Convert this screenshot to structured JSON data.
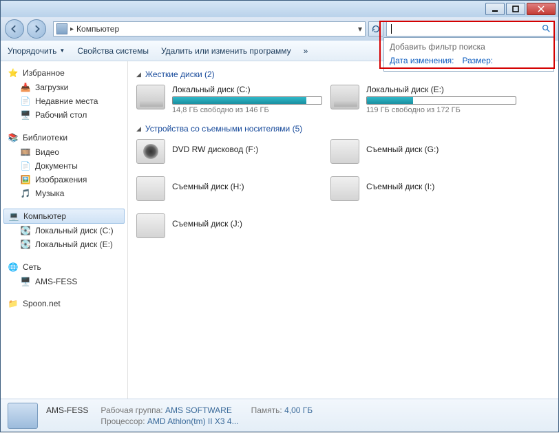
{
  "titlebar": {
    "min": "_",
    "max": "▢",
    "close": "✕"
  },
  "address": {
    "location": "Компьютер"
  },
  "search": {
    "value": "",
    "heading": "Добавить фильтр поиска",
    "filter_date": "Дата изменения:",
    "filter_size": "Размер:"
  },
  "toolbar": {
    "organize": "Упорядочить",
    "properties": "Свойства системы",
    "uninstall": "Удалить или изменить программу",
    "more": "»"
  },
  "sidebar": {
    "favorites": {
      "label": "Избранное",
      "items": [
        "Загрузки",
        "Недавние места",
        "Рабочий стол"
      ]
    },
    "libraries": {
      "label": "Библиотеки",
      "items": [
        "Видео",
        "Документы",
        "Изображения",
        "Музыка"
      ]
    },
    "computer": {
      "label": "Компьютер",
      "items": [
        "Локальный диск (C:)",
        "Локальный диск (E:)"
      ]
    },
    "network": {
      "label": "Сеть",
      "items": [
        "AMS-FESS"
      ]
    },
    "other": [
      "Spoon.net"
    ]
  },
  "sections": {
    "hdd": {
      "title": "Жесткие диски (2)"
    },
    "removable": {
      "title": "Устройства со съемными носителями (5)"
    }
  },
  "drives": [
    {
      "name": "Локальный диск (C:)",
      "free": "14,8 ГБ свободно из 146 ГБ",
      "fill_pct": 90
    },
    {
      "name": "Локальный диск (E:)",
      "free": "119 ГБ свободно из 172 ГБ",
      "fill_pct": 31
    }
  ],
  "devices": [
    {
      "name": "DVD RW дисковод (F:)",
      "kind": "dvd"
    },
    {
      "name": "Съемный диск (G:)",
      "kind": "removable"
    },
    {
      "name": "Съемный диск (H:)",
      "kind": "removable"
    },
    {
      "name": "Съемный диск (I:)",
      "kind": "removable"
    },
    {
      "name": "Съемный диск (J:)",
      "kind": "removable"
    }
  ],
  "status": {
    "name": "AMS-FESS",
    "workgroup_label": "Рабочая группа:",
    "workgroup": "AMS SOFTWARE",
    "mem_label": "Память:",
    "mem": "4,00 ГБ",
    "cpu_label": "Процессор:",
    "cpu": "AMD Athlon(tm) II X3 4..."
  }
}
